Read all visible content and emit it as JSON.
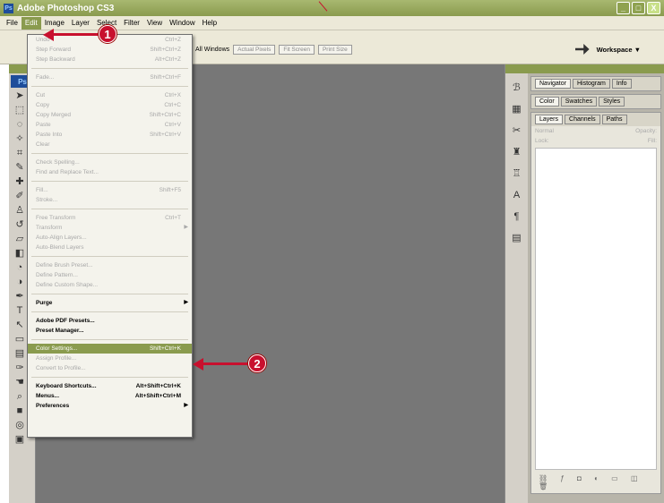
{
  "window": {
    "title": "Adobe Photoshop CS3",
    "logo": "Ps"
  },
  "window_controls": {
    "minimize": "_",
    "maximize": "□",
    "close": "X"
  },
  "menubar": {
    "items": [
      "File",
      "Edit",
      "Image",
      "Layer",
      "Select",
      "Filter",
      "View",
      "Window",
      "Help"
    ]
  },
  "options_bar": {
    "all_windows_label": "All Windows",
    "buttons": [
      "Actual Pixels",
      "Fit Screen",
      "Print Size"
    ],
    "workspace_label": "Workspace ▼"
  },
  "edit_menu": [
    {
      "label": "Undo",
      "shortcut": "Ctrl+Z",
      "state": "disabled"
    },
    {
      "label": "Step Forward",
      "shortcut": "Shift+Ctrl+Z",
      "state": "disabled"
    },
    {
      "label": "Step Backward",
      "shortcut": "Alt+Ctrl+Z",
      "state": "disabled"
    },
    {
      "sep": true
    },
    {
      "label": "Fade...",
      "shortcut": "Shift+Ctrl+F",
      "state": "disabled"
    },
    {
      "sep": true
    },
    {
      "label": "Cut",
      "shortcut": "Ctrl+X",
      "state": "disabled"
    },
    {
      "label": "Copy",
      "shortcut": "Ctrl+C",
      "state": "disabled"
    },
    {
      "label": "Copy Merged",
      "shortcut": "Shift+Ctrl+C",
      "state": "disabled"
    },
    {
      "label": "Paste",
      "shortcut": "Ctrl+V",
      "state": "disabled"
    },
    {
      "label": "Paste Into",
      "shortcut": "Shift+Ctrl+V",
      "state": "disabled"
    },
    {
      "label": "Clear",
      "shortcut": "",
      "state": "disabled"
    },
    {
      "sep": true
    },
    {
      "label": "Check Spelling...",
      "shortcut": "",
      "state": "disabled"
    },
    {
      "label": "Find and Replace Text...",
      "shortcut": "",
      "state": "disabled"
    },
    {
      "sep": true
    },
    {
      "label": "Fill...",
      "shortcut": "Shift+F5",
      "state": "disabled"
    },
    {
      "label": "Stroke...",
      "shortcut": "",
      "state": "disabled"
    },
    {
      "sep": true
    },
    {
      "label": "Free Transform",
      "shortcut": "Ctrl+T",
      "state": "disabled"
    },
    {
      "label": "Transform",
      "shortcut": "",
      "state": "disabled",
      "submenu": true
    },
    {
      "label": "Auto-Align Layers...",
      "shortcut": "",
      "state": "disabled"
    },
    {
      "label": "Auto-Blend Layers",
      "shortcut": "",
      "state": "disabled"
    },
    {
      "sep": true
    },
    {
      "label": "Define Brush Preset...",
      "shortcut": "",
      "state": "disabled"
    },
    {
      "label": "Define Pattern...",
      "shortcut": "",
      "state": "disabled"
    },
    {
      "label": "Define Custom Shape...",
      "shortcut": "",
      "state": "disabled"
    },
    {
      "sep": true
    },
    {
      "label": "Purge",
      "shortcut": "",
      "state": "bold",
      "submenu": true
    },
    {
      "sep": true
    },
    {
      "label": "Adobe PDF Presets...",
      "shortcut": "",
      "state": "bold"
    },
    {
      "label": "Preset Manager...",
      "shortcut": "",
      "state": "bold"
    },
    {
      "sep": true
    },
    {
      "label": "Color Settings...",
      "shortcut": "Shift+Ctrl+K",
      "state": "selected"
    },
    {
      "label": "Assign Profile...",
      "shortcut": "",
      "state": "disabled"
    },
    {
      "label": "Convert to Profile...",
      "shortcut": "",
      "state": "disabled"
    },
    {
      "sep": true
    },
    {
      "label": "Keyboard Shortcuts...",
      "shortcut": "Alt+Shift+Ctrl+K",
      "state": "bold"
    },
    {
      "label": "Menus...",
      "shortcut": "Alt+Shift+Ctrl+M",
      "state": "bold"
    },
    {
      "label": "Preferences",
      "shortcut": "",
      "state": "bold",
      "submenu": true
    }
  ],
  "panels": {
    "group1_tabs": [
      "Navigator",
      "Histogram",
      "Info"
    ],
    "group2_tabs": [
      "Color",
      "Swatches",
      "Styles"
    ],
    "group3_tabs": [
      "Layers",
      "Channels",
      "Paths"
    ],
    "blend_mode": "Normal",
    "opacity_label": "Opacity:",
    "lock_label": "Lock:",
    "fill_label": "Fill:"
  },
  "callouts": {
    "one": "1",
    "two": "2"
  },
  "colors": {
    "accent": "#8a9b4e",
    "callout": "#c8102e",
    "canvas": "#777777"
  }
}
